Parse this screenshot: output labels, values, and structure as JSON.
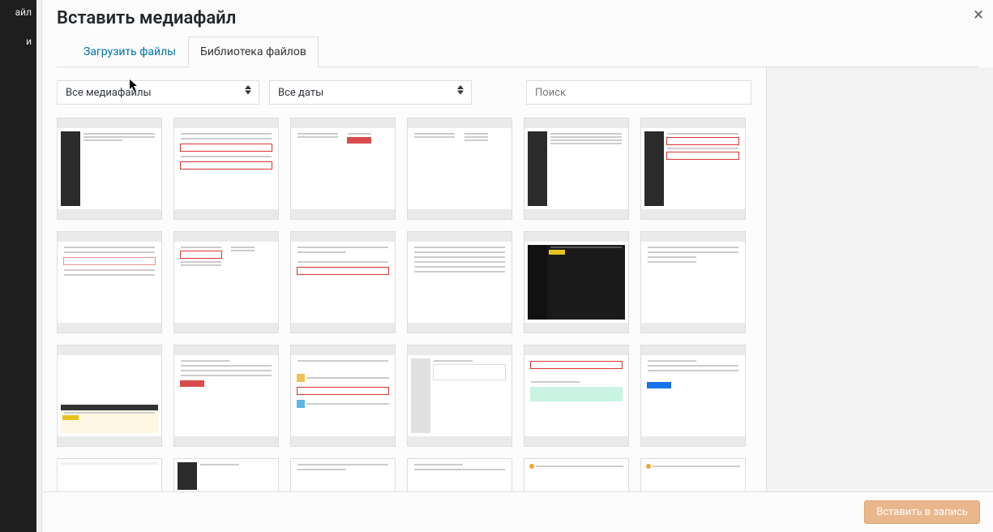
{
  "sidebar": {
    "item1": "айл",
    "item2": "и"
  },
  "modal": {
    "title": "Вставить медиафайл",
    "close_label": "×"
  },
  "tabs": {
    "upload": "Загрузить файлы",
    "library": "Библиотека файлов"
  },
  "filters": {
    "type_value": "Все медиафайлы",
    "date_value": "Все даты"
  },
  "search": {
    "placeholder": "Поиск"
  },
  "thumbnails": {
    "count_full_rows": 3,
    "count_partial_row": 6
  },
  "footer": {
    "insert_label": "Вставить в запись"
  }
}
